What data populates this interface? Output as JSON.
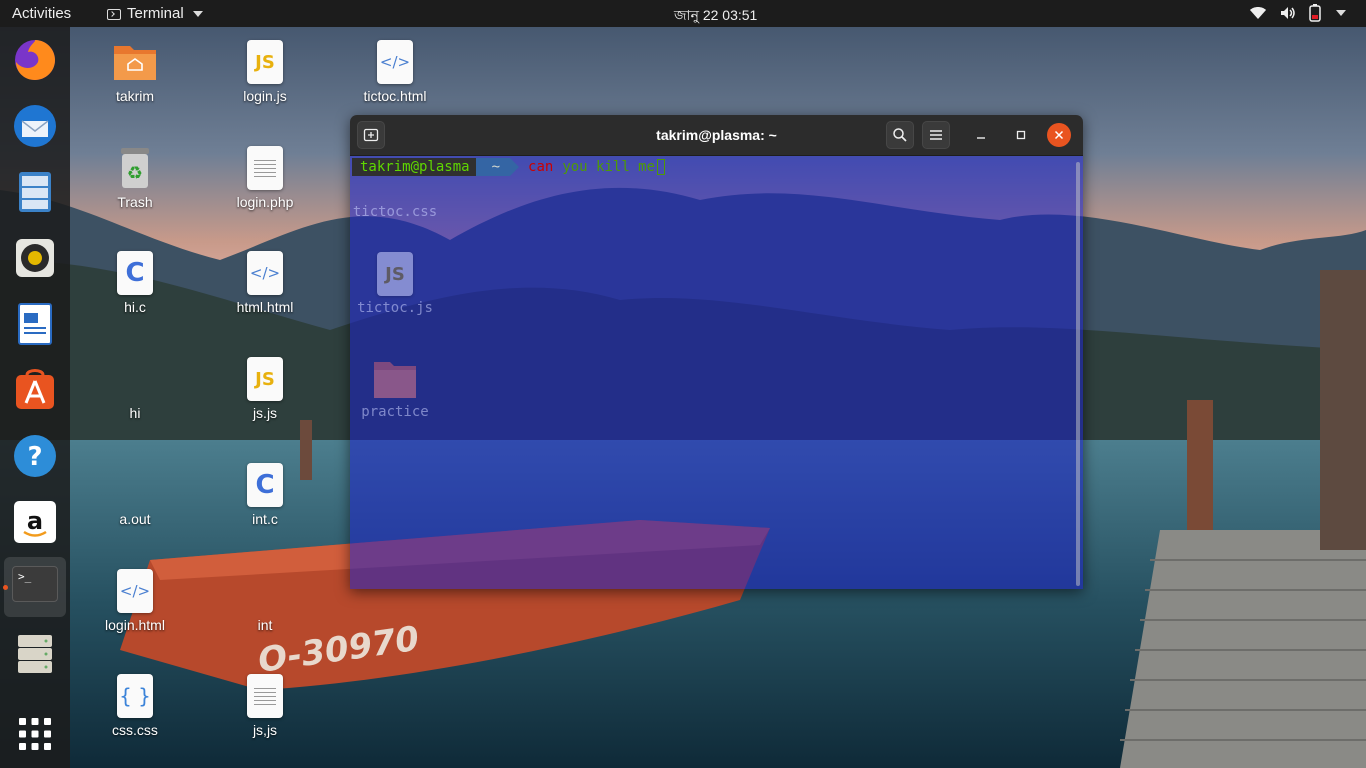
{
  "topbar": {
    "activities": "Activities",
    "app_menu": "Terminal",
    "clock": "জানু 22  03:51"
  },
  "dock": {
    "items": [
      {
        "name": "firefox-icon"
      },
      {
        "name": "thunderbird-icon"
      },
      {
        "name": "files-icon"
      },
      {
        "name": "rhythmbox-icon"
      },
      {
        "name": "libreoffice-writer-icon"
      },
      {
        "name": "ubuntu-software-icon"
      },
      {
        "name": "help-icon"
      },
      {
        "name": "amazon-icon"
      },
      {
        "name": "terminal-icon"
      },
      {
        "name": "storage-icon"
      },
      {
        "name": "show-applications-icon"
      }
    ],
    "terminal_glyph": ">_"
  },
  "desktop": {
    "icons": [
      {
        "label": "takrim",
        "type": "home-folder"
      },
      {
        "label": "Trash",
        "type": "trash"
      },
      {
        "label": "hi.c",
        "type": "c"
      },
      {
        "label": "hi",
        "type": "executable"
      },
      {
        "label": "a.out",
        "type": "executable"
      },
      {
        "label": "login.html",
        "type": "html"
      },
      {
        "label": "css.css",
        "type": "css"
      },
      {
        "label": "login.js",
        "type": "js"
      },
      {
        "label": "login.php",
        "type": "text"
      },
      {
        "label": "html.html",
        "type": "html"
      },
      {
        "label": "js.js",
        "type": "js"
      },
      {
        "label": "int.c",
        "type": "c"
      },
      {
        "label": "int",
        "type": "executable"
      },
      {
        "label": "js,js",
        "type": "text"
      },
      {
        "label": "tictoc.html",
        "type": "html"
      },
      {
        "label": "tictoc.css",
        "type": "css"
      },
      {
        "label": "tictoc.js",
        "type": "js"
      },
      {
        "label": "practice",
        "type": "folder"
      }
    ],
    "glyphs": {
      "js": "JS",
      "c": "C",
      "html": "</>",
      "css": "{ }"
    }
  },
  "terminal": {
    "title": "takrim@plasma: ~",
    "prompt_user": "takrim@plasma",
    "prompt_dir": "~",
    "command_word": "can",
    "command_args": "you kill me",
    "colors": {
      "user": "#5fd700",
      "dir_bg": "#3465a4",
      "error": "#cc0000",
      "ok": "#4e9a06",
      "close": "#e95420"
    }
  },
  "wallpaper": {
    "boat_text": "O-30970"
  }
}
